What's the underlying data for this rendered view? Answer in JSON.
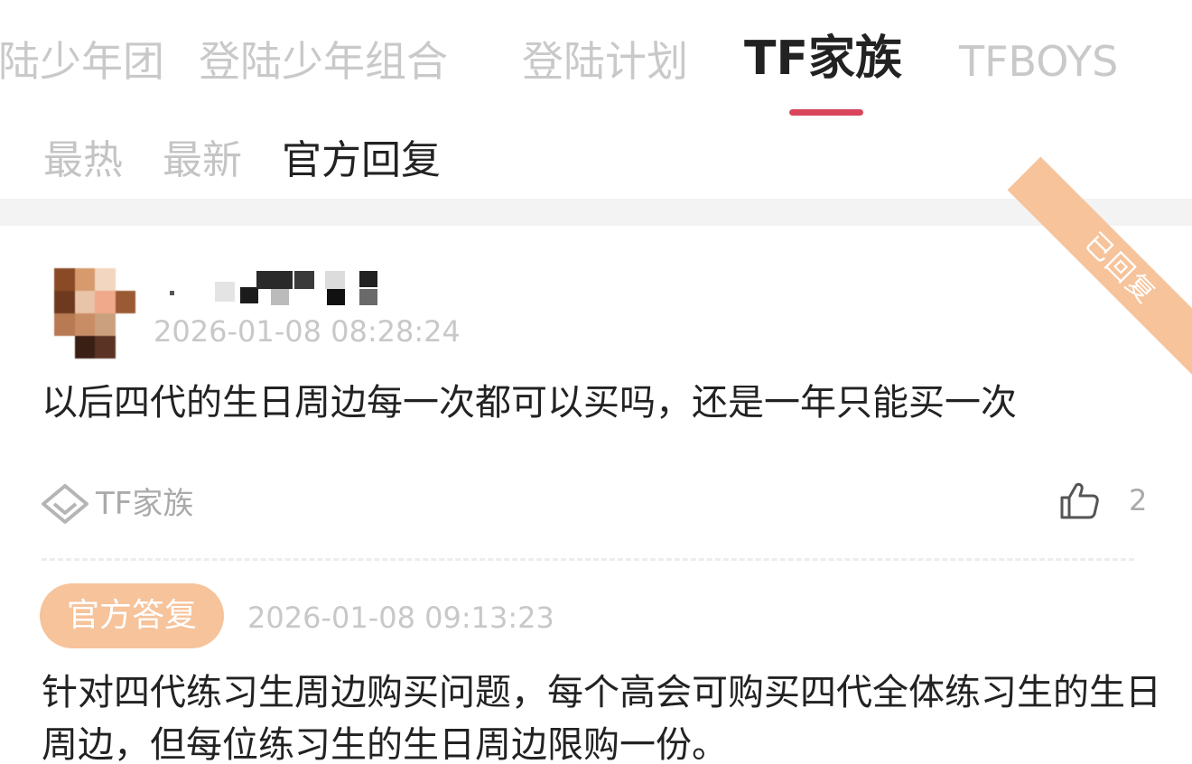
{
  "top_tabs": [
    {
      "label": "登陆少年团"
    },
    {
      "label": "登陆少年组合"
    },
    {
      "label": "登陆计划"
    },
    {
      "label": "TF家族",
      "active": true
    },
    {
      "label": "TFBOYS"
    }
  ],
  "sub_tabs": [
    {
      "label": "最热"
    },
    {
      "label": "最新"
    },
    {
      "label": "官方回复",
      "active": true
    }
  ],
  "question": {
    "avatar_icon": "user-avatar-pixelated",
    "username": "(blurred username)",
    "timestamp": "2026-01-08 08:28:24",
    "text": "以后四代的生日周边每一次都可以买吗，还是一年只能买一次",
    "status_ribbon": "已回复",
    "topic_icon": "diamond-tag-icon",
    "topic": "TF家族",
    "like_icon": "thumbs-up-icon",
    "like_count": "2"
  },
  "answer": {
    "badge": "官方答复",
    "timestamp": "2026-01-08 09:13:23",
    "text": "针对四代练习生周边购买问题，每个高会可购买四代全体练习生的生日周边，但每位练习生的生日周边限购一份。"
  },
  "colors": {
    "accent_red": "#d8455d",
    "badge_orange": "#f6c39b",
    "muted_text": "#c8c8c8",
    "primary_text": "#222222"
  }
}
